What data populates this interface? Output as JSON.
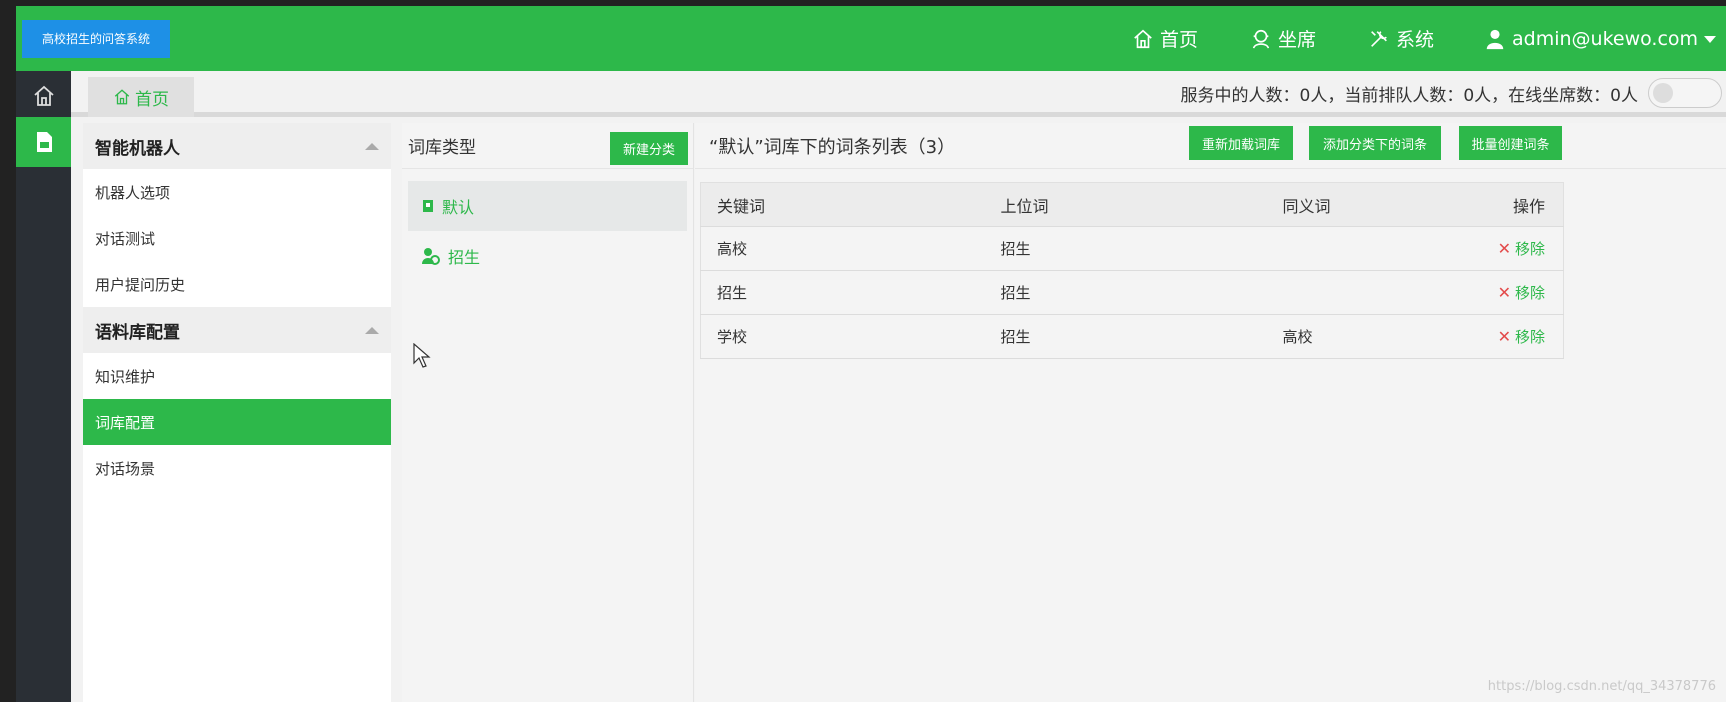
{
  "app": {
    "logo_text": "高校招生的问答系统"
  },
  "topnav": {
    "home": "首页",
    "agent": "坐席",
    "system": "系统",
    "user": "admin@ukewo.com"
  },
  "tabs": {
    "home": "首页"
  },
  "status": {
    "text": "服务中的人数：0人，当前排队人数：0人，在线坐席数：0人"
  },
  "sidebar": {
    "groups": [
      {
        "title": "智能机器人",
        "items": [
          "机器人选项",
          "对话测试",
          "用户提问历史"
        ]
      },
      {
        "title": "语料库配置",
        "items": [
          "知识维护",
          "词库配置",
          "对话场景"
        ]
      }
    ],
    "active": "词库配置"
  },
  "category_panel": {
    "title": "词库类型",
    "new_button": "新建分类",
    "items": [
      "默认",
      "招生"
    ],
    "selected": "默认"
  },
  "main": {
    "title": "“默认”词库下的词条列表（3）",
    "buttons": {
      "reload": "重新加载词库",
      "add_word": "添加分类下的词条",
      "batch_create": "批量创建词条"
    },
    "table": {
      "columns": [
        "关键词",
        "上位词",
        "同义词",
        "操作"
      ],
      "rows": [
        {
          "keyword": "高校",
          "hypernym": "招生",
          "synonym": "",
          "action": "移除"
        },
        {
          "keyword": "招生",
          "hypernym": "招生",
          "synonym": "",
          "action": "移除"
        },
        {
          "keyword": "学校",
          "hypernym": "招生",
          "synonym": "高校",
          "action": "移除"
        }
      ]
    }
  },
  "watermark": "https://blog.csdn.net/qq_34378776",
  "colors": {
    "brand_green": "#2db84a",
    "logo_blue": "#1e90e6",
    "rail_dark": "#2a2f35",
    "remove_red": "#e34b4b"
  }
}
